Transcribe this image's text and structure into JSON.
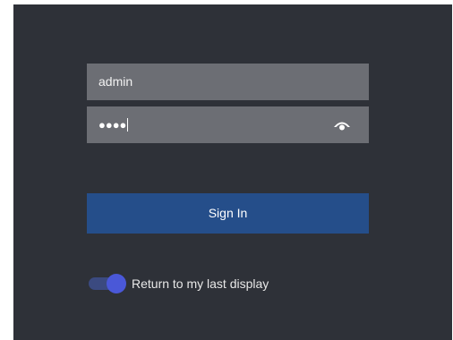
{
  "login": {
    "username_value": "admin",
    "password_masked": "●●●●",
    "show_password_icon": "eye-icon",
    "sign_in_label": "Sign In",
    "remember_toggle": {
      "label": "Return to my last display",
      "checked": true
    }
  },
  "colors": {
    "panel_bg": "#2e3138",
    "field_bg": "#6c6e74",
    "button_bg": "#254e8a",
    "toggle_accent": "#4a58d8"
  }
}
